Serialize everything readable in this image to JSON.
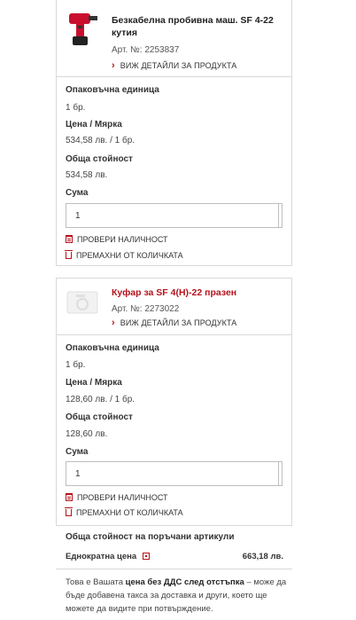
{
  "items": [
    {
      "title": "Безкабелна пробивна маш. SF 4-22 кутия",
      "article": "Арт. №: 2253837",
      "details_link": "ВИЖ ДЕТАЙЛИ ЗА ПРОДУКТА",
      "packaging_label": "Опаковъчна единица",
      "packaging_value": "1 бр.",
      "price_label": "Цена / Мярка",
      "price_value": "534,58 лв. / 1 бр.",
      "total_label": "Обща стойност",
      "total_value": "534,58 лв.",
      "qty_label": "Сума",
      "qty_value": "1",
      "check_stock": "ПРОВЕРИ НАЛИЧНОСТ",
      "remove_qty": "ПРЕМАХНИ ОТ КОЛИЧКАТА"
    },
    {
      "title": "Куфар за SF 4(H)-22 празен",
      "article": "Арт. №: 2273022",
      "details_link": "ВИЖ ДЕТАЙЛИ ЗА ПРОДУКТА",
      "packaging_label": "Опаковъчна единица",
      "packaging_value": "1 бр.",
      "price_label": "Цена / Мярка",
      "price_value": "128,60 лв. / 1 бр.",
      "total_label": "Обща стойност",
      "total_value": "128,60 лв.",
      "qty_label": "Сума",
      "qty_value": "1",
      "check_stock": "ПРОВЕРИ НАЛИЧНОСТ",
      "remove_qty": "ПРЕМАХНИ ОТ КОЛИЧКАТА"
    }
  ],
  "summary": {
    "title": "Обща стойност на поръчани артикули",
    "one_time_label": "Еднократна цена",
    "one_time_value": "663,18 лв.",
    "note_prefix": "Това е Вашата ",
    "note_bold": "цена без ДДС след отстъпка",
    "note_suffix": " – може да бъде добавена такса за доставка и други, което ще можете да видите при потвърждение."
  },
  "colors": {
    "accent": "#b5121b",
    "border": "#d9d9d9"
  }
}
